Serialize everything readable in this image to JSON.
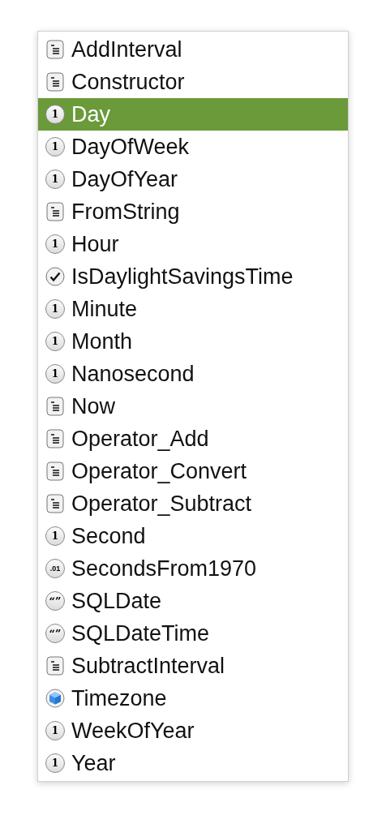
{
  "items": [
    {
      "label": "AddInterval",
      "kind": "method",
      "selected": false
    },
    {
      "label": "Constructor",
      "kind": "method",
      "selected": false
    },
    {
      "label": "Day",
      "kind": "integer",
      "glyph": "1",
      "selected": true
    },
    {
      "label": "DayOfWeek",
      "kind": "integer",
      "glyph": "1",
      "selected": false
    },
    {
      "label": "DayOfYear",
      "kind": "integer",
      "glyph": "1",
      "selected": false
    },
    {
      "label": "FromString",
      "kind": "method",
      "selected": false
    },
    {
      "label": "Hour",
      "kind": "integer",
      "glyph": "1",
      "selected": false
    },
    {
      "label": "IsDaylightSavingsTime",
      "kind": "boolean",
      "selected": false
    },
    {
      "label": "Minute",
      "kind": "integer",
      "glyph": "1",
      "selected": false
    },
    {
      "label": "Month",
      "kind": "integer",
      "glyph": "1",
      "selected": false
    },
    {
      "label": "Nanosecond",
      "kind": "integer",
      "glyph": "1",
      "selected": false
    },
    {
      "label": "Now",
      "kind": "method",
      "selected": false
    },
    {
      "label": "Operator_Add",
      "kind": "method",
      "selected": false
    },
    {
      "label": "Operator_Convert",
      "kind": "method",
      "selected": false
    },
    {
      "label": "Operator_Subtract",
      "kind": "method",
      "selected": false
    },
    {
      "label": "Second",
      "kind": "integer",
      "glyph": "1",
      "selected": false
    },
    {
      "label": "SecondsFrom1970",
      "kind": "double",
      "glyph": ".01",
      "selected": false
    },
    {
      "label": "SQLDate",
      "kind": "string",
      "glyph": "“”",
      "selected": false
    },
    {
      "label": "SQLDateTime",
      "kind": "string",
      "glyph": "“”",
      "selected": false
    },
    {
      "label": "SubtractInterval",
      "kind": "method",
      "selected": false
    },
    {
      "label": "Timezone",
      "kind": "class",
      "selected": false
    },
    {
      "label": "WeekOfYear",
      "kind": "integer",
      "glyph": "1",
      "selected": false
    },
    {
      "label": "Year",
      "kind": "integer",
      "glyph": "1",
      "selected": false
    }
  ]
}
